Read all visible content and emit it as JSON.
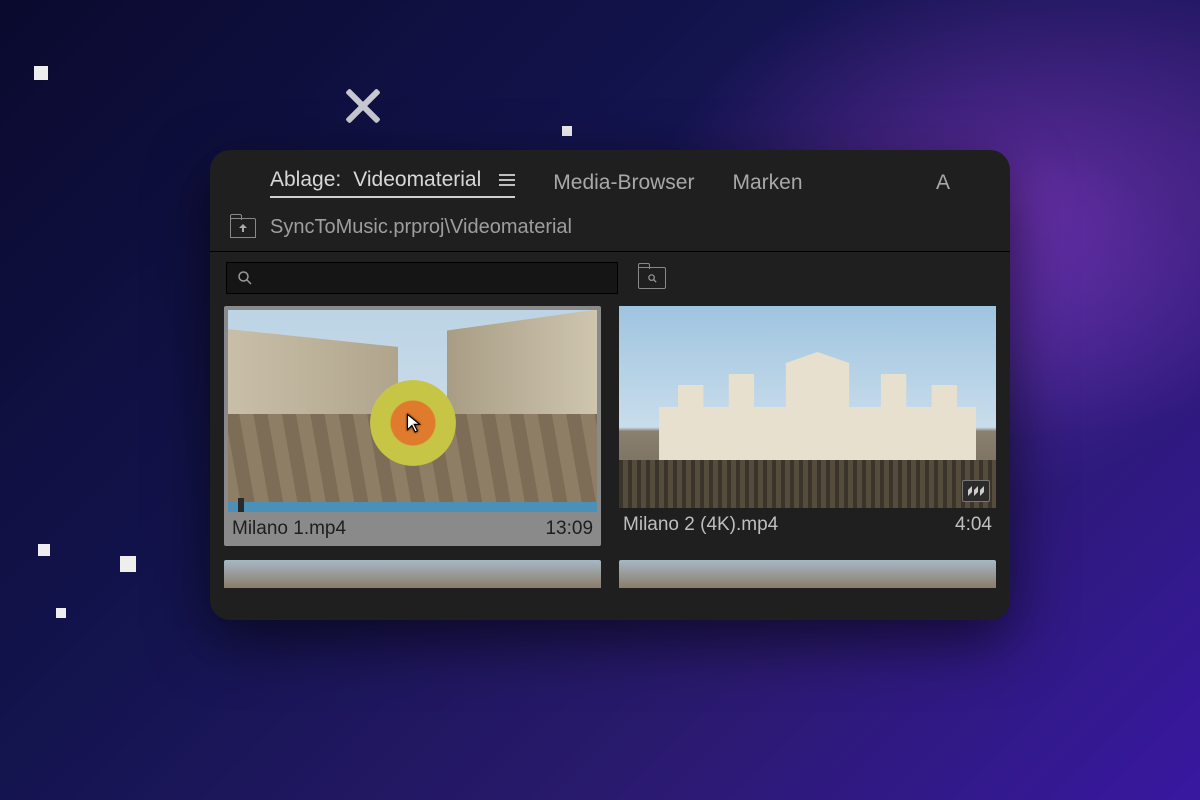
{
  "tabs": {
    "active_prefix": "Ablage:",
    "active_name": "Videomaterial",
    "media_browser": "Media-Browser",
    "marken": "Marken",
    "cut": "A"
  },
  "breadcrumb": "SyncToMusic.prproj\\Videomaterial",
  "search": {
    "value": ""
  },
  "clips": [
    {
      "name": "Milano 1.mp4",
      "duration": "13:09"
    },
    {
      "name": "Milano 2 (4K).mp4",
      "duration": "4:04"
    }
  ]
}
